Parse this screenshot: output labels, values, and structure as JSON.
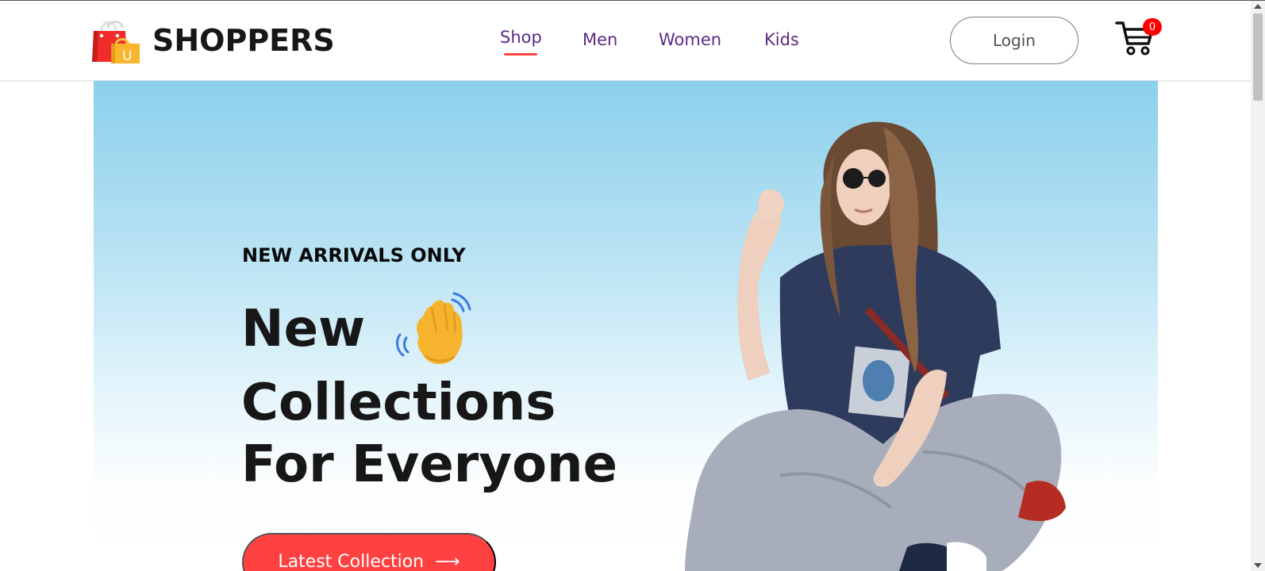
{
  "brand": {
    "name": "SHOPPERS",
    "logo_letter": "U",
    "logo_icon": "shopping-bags-icon"
  },
  "nav": {
    "items": [
      {
        "label": "Shop",
        "active": true
      },
      {
        "label": "Men",
        "active": false
      },
      {
        "label": "Women",
        "active": false
      },
      {
        "label": "Kids",
        "active": false
      }
    ]
  },
  "header": {
    "login_label": "Login",
    "cart_icon": "cart-icon",
    "cart_count": "0"
  },
  "hero": {
    "subtitle": "NEW ARRIVALS ONLY",
    "line1": "New",
    "wave_icon": "waving-hand-icon",
    "line2": "Collections",
    "line3": "For Everyone",
    "cta_label": "Latest Collection",
    "cta_arrow": "⟶",
    "image_icon": "hero-model-image"
  },
  "colors": {
    "accent": "#ff4141",
    "nav_text": "#5c2b86",
    "hero_gradient_top": "#8bd0ec",
    "hero_gradient_bottom": "#ffffff",
    "cart_badge": "#ff0000"
  }
}
